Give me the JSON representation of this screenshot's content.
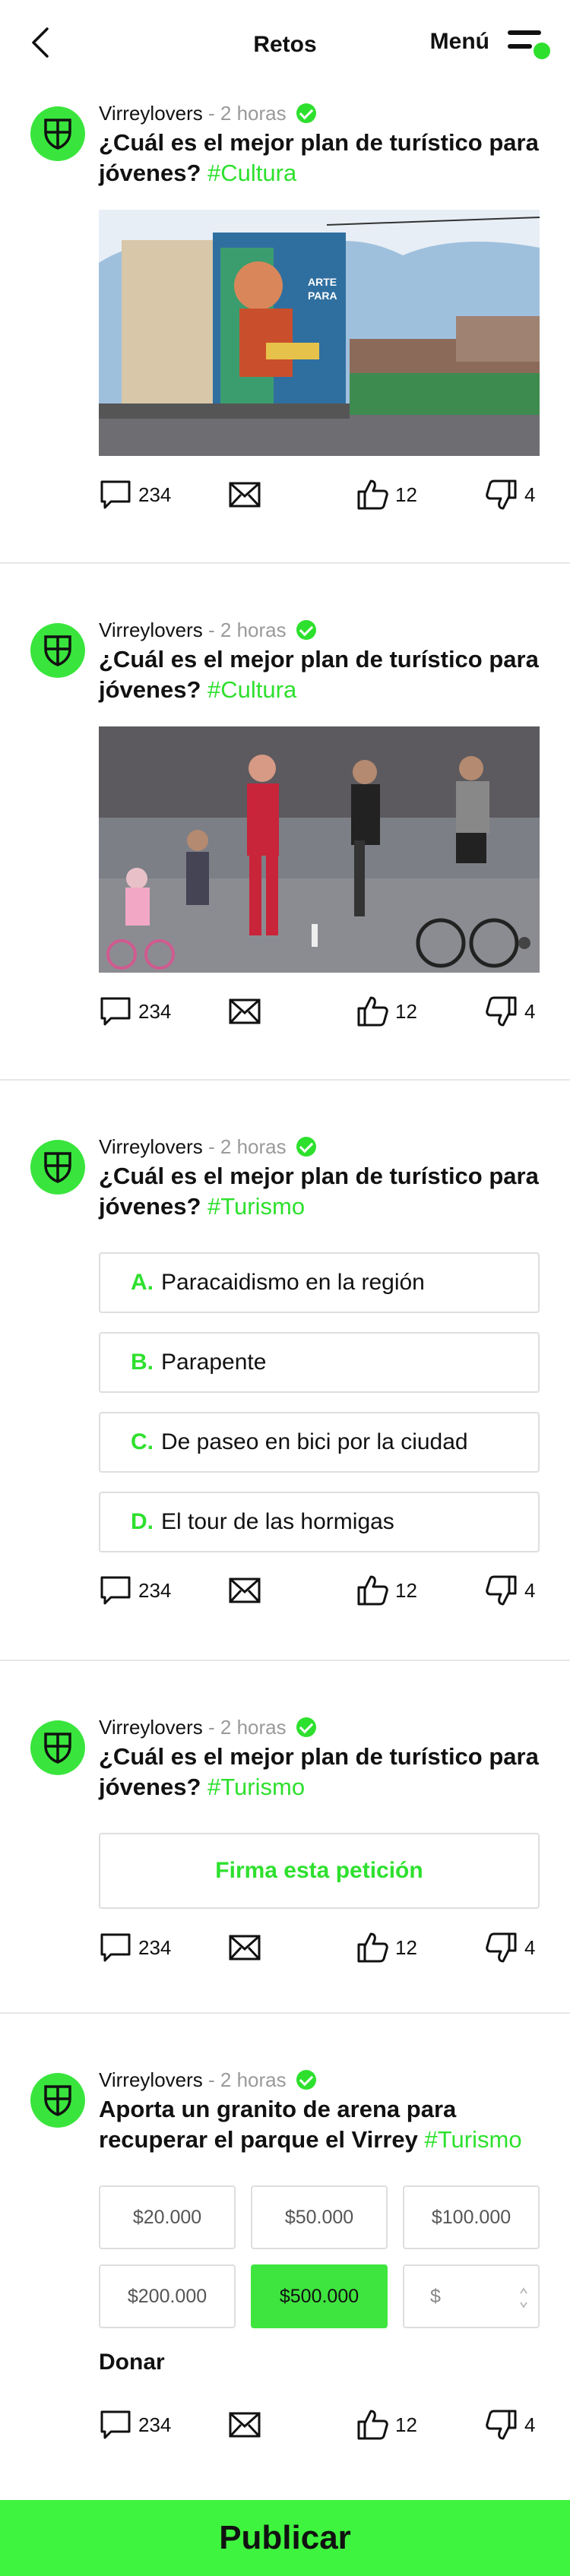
{
  "header": {
    "title": "Retos",
    "menu_label": "Menú"
  },
  "posts": [
    {
      "author": "Virreylovers",
      "time": "- 2 horas",
      "title": "¿Cuál es el mejor plan de turístico para jóvenes?",
      "tag": "#Cultura",
      "comments": "234",
      "likes": "12",
      "dislikes": "4"
    },
    {
      "author": "Virreylovers",
      "time": "- 2 horas",
      "title": "¿Cuál es el mejor plan de turístico para jóvenes?",
      "tag": "#Cultura",
      "comments": "234",
      "likes": "12",
      "dislikes": "4"
    },
    {
      "author": "Virreylovers",
      "time": "- 2 horas",
      "title": "¿Cuál es el mejor plan de turístico para jóvenes?",
      "tag": "#Turismo",
      "comments": "234",
      "likes": "12",
      "dislikes": "4",
      "options": [
        {
          "letter": "A.",
          "text": "Paracaidismo en la región"
        },
        {
          "letter": "B.",
          "text": "Parapente"
        },
        {
          "letter": "C.",
          "text": "De paseo en bici por la ciudad"
        },
        {
          "letter": "D.",
          "text": "El tour de las hormigas"
        }
      ]
    },
    {
      "author": "Virreylovers",
      "time": "- 2 horas",
      "title": "¿Cuál es el mejor plan de turístico para jóvenes?",
      "tag": "#Turismo",
      "comments": "234",
      "likes": "12",
      "dislikes": "4",
      "petition_label": "Firma esta petición"
    },
    {
      "author": "Virreylovers",
      "time": "- 2 horas",
      "title": "Aporta un granito de arena para recuperar el parque el Virrey",
      "tag": "#Turismo",
      "comments": "234",
      "likes": "12",
      "dislikes": "4",
      "amounts": [
        "$20.000",
        "$50.000",
        "$100.000",
        "$200.000",
        "$500.000"
      ],
      "selected_amount": "$500.000",
      "custom_amount_placeholder": "$",
      "donate_label": "Donar"
    }
  ],
  "publish_label": "Publicar",
  "colors": {
    "accent": "#2ee02e",
    "publish_bg": "#3ff43f",
    "avatar": "#39e53c"
  }
}
